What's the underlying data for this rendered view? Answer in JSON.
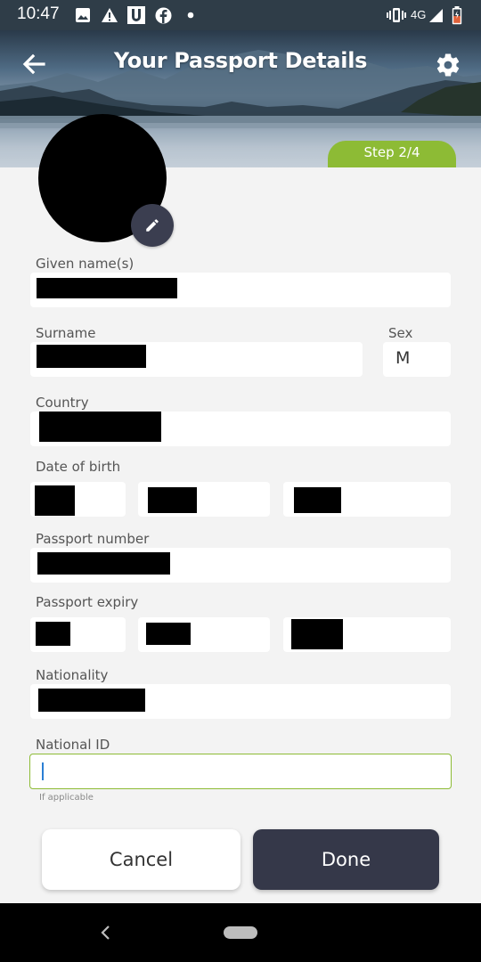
{
  "status_bar": {
    "time": "10:47",
    "network": "4G",
    "icons": [
      "image-icon",
      "warning-icon",
      "u-app-icon",
      "facebook-icon",
      "dot-icon",
      "vibrate-icon",
      "signal-icon",
      "battery-icon"
    ]
  },
  "header": {
    "title": "Your Passport Details",
    "step": "Step 2/4",
    "back_icon": "arrow-left-icon",
    "settings_icon": "gear-icon"
  },
  "form": {
    "given_names_label": "Given name(s)",
    "surname_label": "Surname",
    "sex_label": "Sex",
    "sex_value": "M",
    "country_label": "Country",
    "dob_label": "Date of birth",
    "passport_number_label": "Passport number",
    "passport_expiry_label": "Passport expiry",
    "nationality_label": "Nationality",
    "national_id_label": "National ID",
    "national_id_hint": "If applicable",
    "national_id_value": ""
  },
  "buttons": {
    "cancel": "Cancel",
    "done": "Done"
  },
  "colors": {
    "accent": "#8dbb35",
    "primary_button": "#353849",
    "edit_button": "#3b3e50",
    "status_bar": "#2f3d48"
  }
}
